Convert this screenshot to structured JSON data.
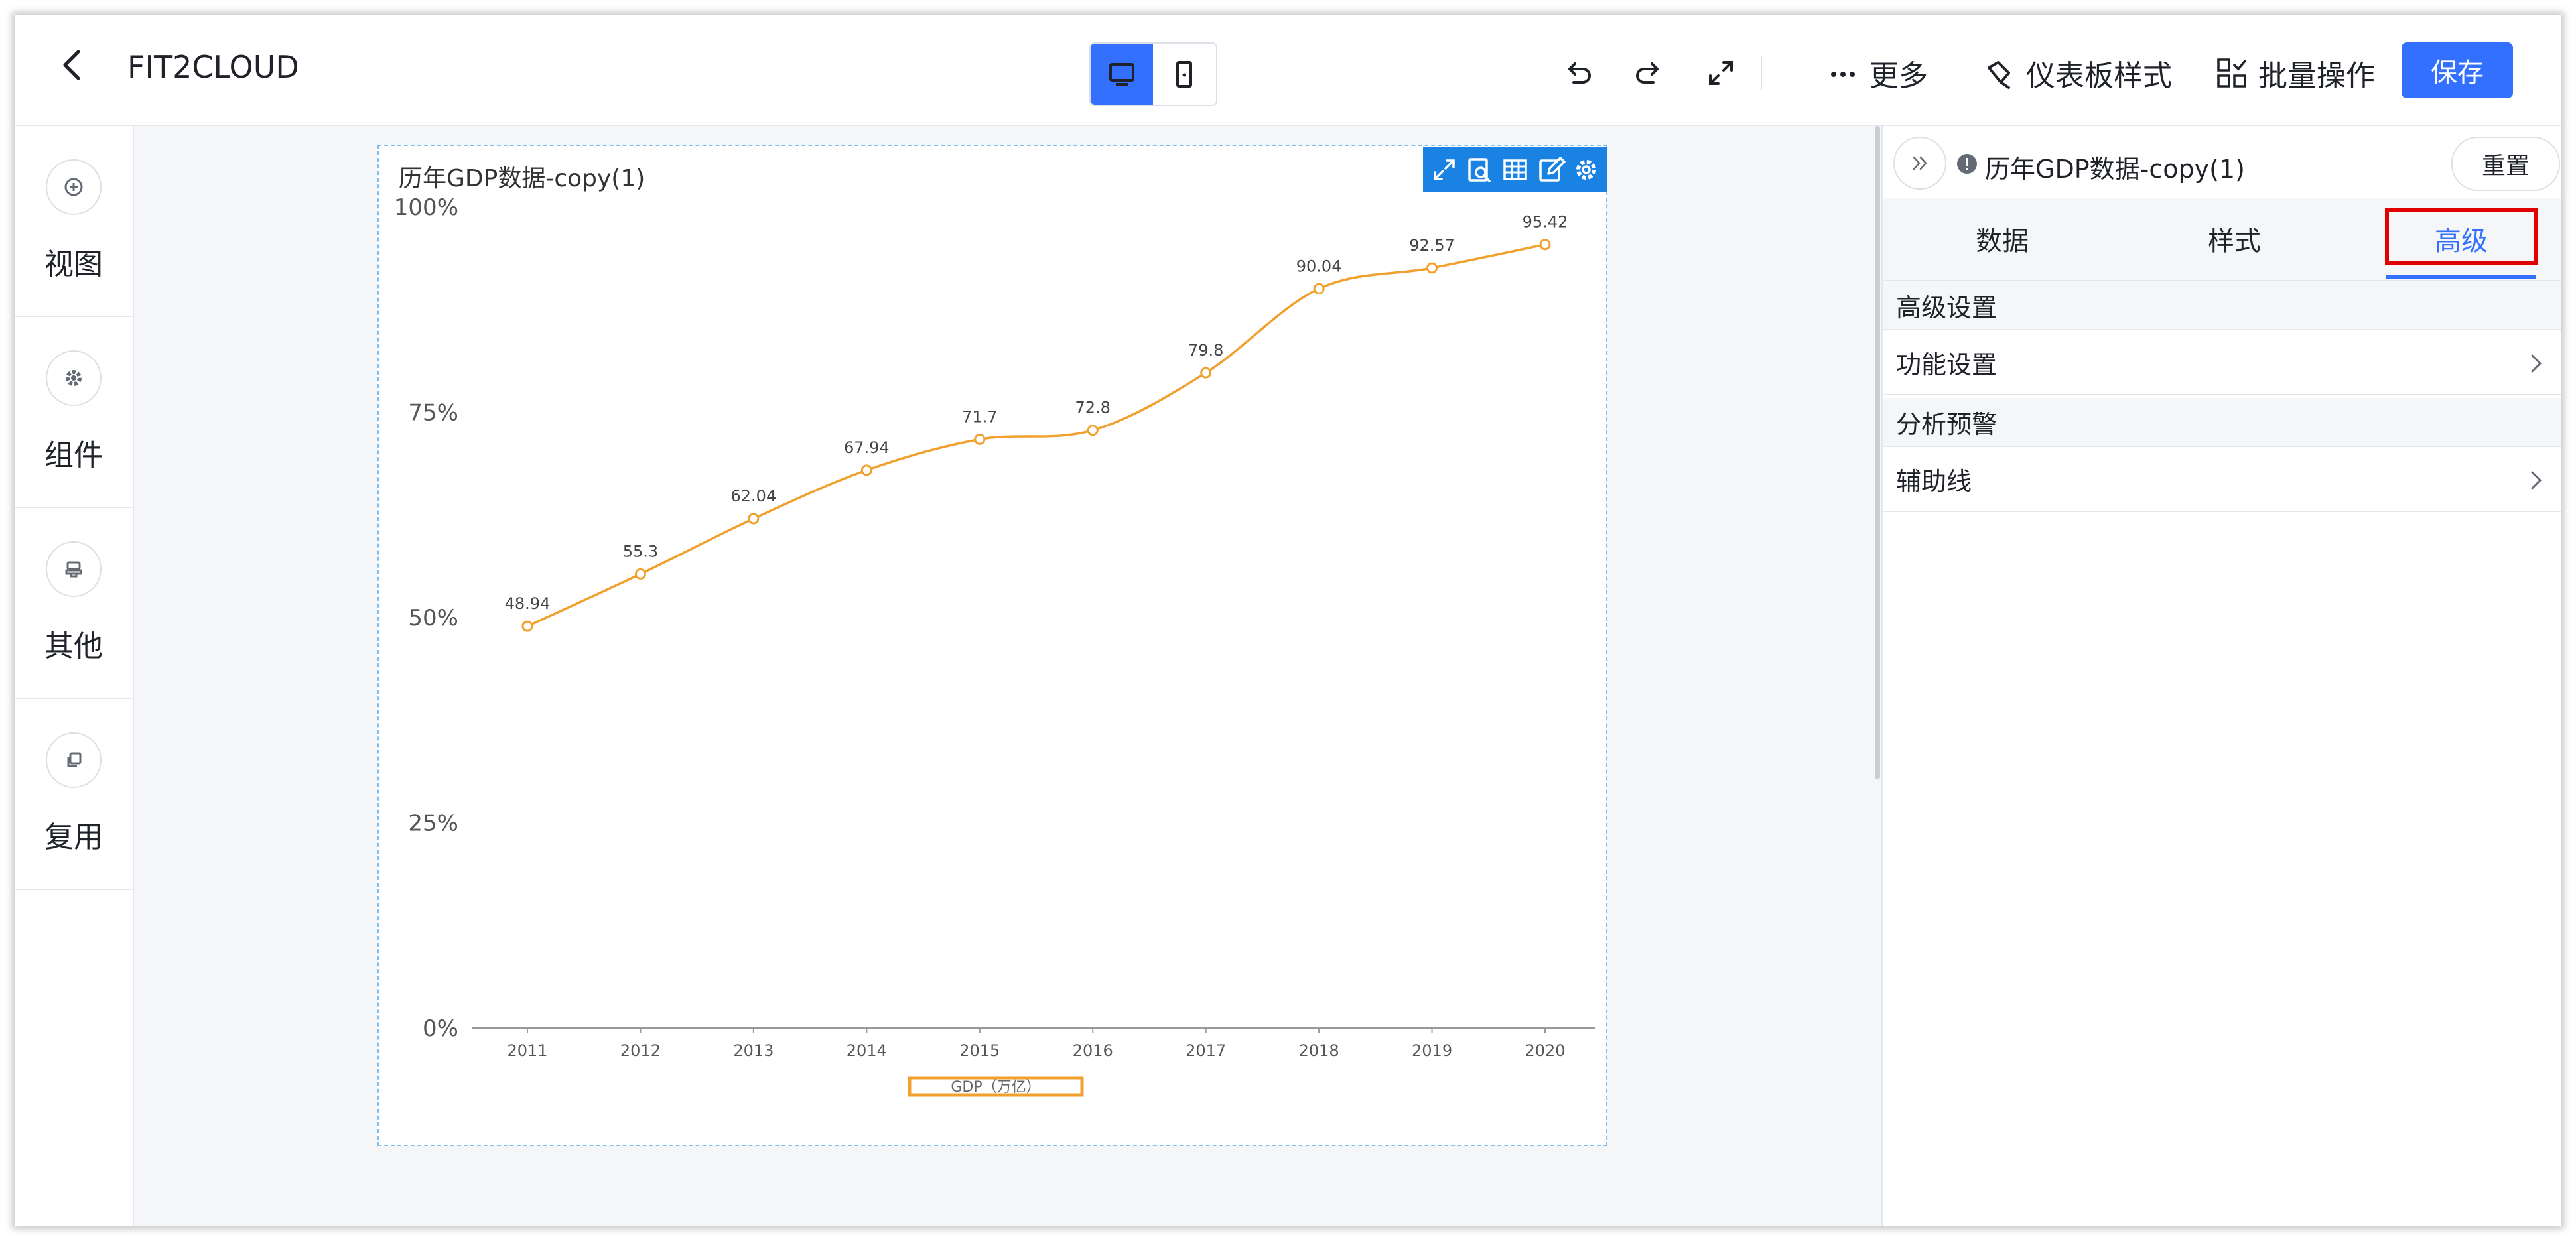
{
  "header": {
    "back_icon": "chevron-left-icon",
    "title": "FIT2CLOUD",
    "device_modes": [
      "desktop-icon",
      "mobile-icon"
    ],
    "active_device": "desktop",
    "icons": [
      "undo-icon",
      "redo-icon",
      "fullscreen-icon"
    ],
    "more_label": "更多",
    "dashboard_style_label": "仪表板样式",
    "batch_label": "批量操作",
    "save_label": "保存",
    "accent_color": "#3370ff"
  },
  "sidebar": {
    "items": [
      {
        "label": "视图",
        "icon": "plus-circle-icon"
      },
      {
        "label": "组件",
        "icon": "gear-icon"
      },
      {
        "label": "其他",
        "icon": "stamp-icon"
      },
      {
        "label": "复用",
        "icon": "copy-icon"
      }
    ]
  },
  "chart": {
    "title": "历年GDP数据-copy(1)",
    "toolbar_icons": [
      "expand-icon",
      "search-detail-icon",
      "table-icon",
      "edit-icon",
      "settings-icon"
    ],
    "legend_label": "GDP（万亿）"
  },
  "chart_data": {
    "type": "line",
    "title": "历年GDP数据-copy(1)",
    "x": [
      "2011",
      "2012",
      "2013",
      "2014",
      "2015",
      "2016",
      "2017",
      "2018",
      "2019",
      "2020"
    ],
    "series": [
      {
        "name": "GDP（万亿）",
        "values": [
          48.94,
          55.3,
          62.04,
          67.94,
          71.7,
          72.8,
          79.8,
          90.04,
          92.57,
          95.42
        ],
        "color": "#f0a02c"
      }
    ],
    "y_ticks": [
      "0%",
      "25%",
      "50%",
      "75%",
      "100%"
    ],
    "ylim": [
      0,
      100
    ],
    "smooth": true,
    "grid": false,
    "legend_position": "bottom-center"
  },
  "panel": {
    "title": "历年GDP数据-copy(1)",
    "reset_label": "重置",
    "tabs": [
      "数据",
      "样式",
      "高级"
    ],
    "active_tab": "高级",
    "sections": [
      {
        "heading": "高级设置",
        "rows": [
          "功能设置"
        ]
      },
      {
        "heading": "分析预警",
        "rows": [
          "辅助线"
        ]
      }
    ]
  }
}
